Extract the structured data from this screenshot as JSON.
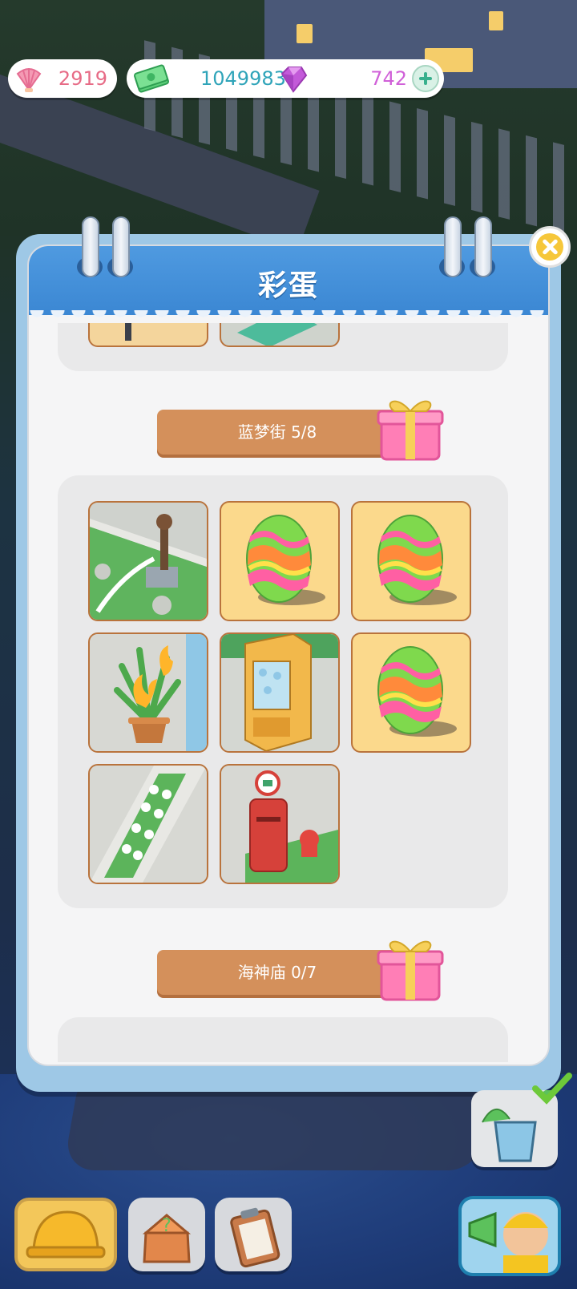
{
  "resources": {
    "shells": "2919",
    "cash": "1049983",
    "gems": "742"
  },
  "panel": {
    "title": "彩蛋"
  },
  "sections": [
    {
      "label": "蓝梦街 5/8"
    },
    {
      "label": "海神庙 0/7"
    }
  ],
  "tiles": [
    {
      "type": "scene",
      "name": "water-pump"
    },
    {
      "type": "egg",
      "name": "hidden-egg"
    },
    {
      "type": "egg",
      "name": "hidden-egg"
    },
    {
      "type": "scene",
      "name": "burning-plant"
    },
    {
      "type": "scene",
      "name": "vending-machine"
    },
    {
      "type": "egg",
      "name": "hidden-egg"
    },
    {
      "type": "scene",
      "name": "flower-bed"
    },
    {
      "type": "scene",
      "name": "mailbox-hydrant"
    }
  ],
  "bottom_bar": [
    "hard-hat-icon",
    "toolbox-icon",
    "clipboard-icon"
  ],
  "colors": {
    "header_blue": "#3b87d3",
    "section_label": "#d4905b",
    "egg_tile": "#fbd98c",
    "shell_text": "#e76b86",
    "cash_text": "#2fa4b9",
    "gem_text": "#d060d8"
  }
}
